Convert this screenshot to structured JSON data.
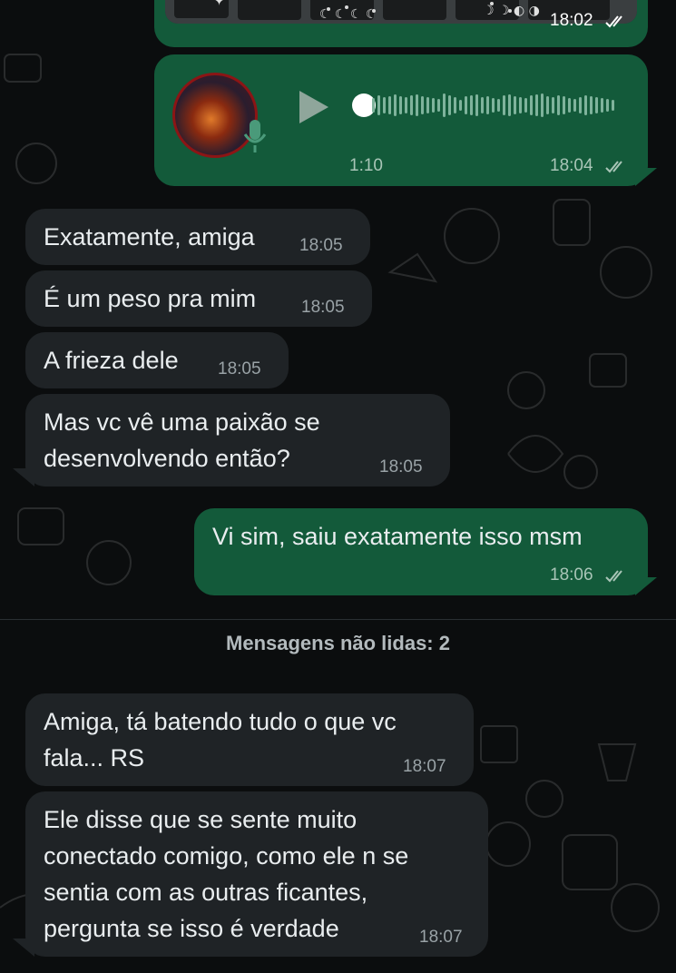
{
  "colors": {
    "background": "#0b0d0e",
    "incoming_bubble": "#1f2326",
    "outgoing_bubble": "#135a3a",
    "timestamp": "#9aa3a7"
  },
  "image_message": {
    "time": "18:02"
  },
  "voice_message": {
    "duration": "1:10",
    "time": "18:04",
    "icon": "play-icon",
    "progress": 0
  },
  "messages": [
    {
      "text": "Exatamente, amiga",
      "time": "18:05"
    },
    {
      "text": "É um peso pra mim",
      "time": "18:05"
    },
    {
      "text": "A frieza dele",
      "time": "18:05"
    },
    {
      "text": "Mas vc vê uma paixão se\ndesenvolvendo então?",
      "time": "18:05"
    },
    {
      "text": "Vi sim, saiu exatamente isso msm",
      "time": "18:06"
    },
    {
      "text": "Amiga, tá batendo tudo o que vc\nfala... RS",
      "time": "18:07"
    },
    {
      "text": "Ele disse que se sente muito\nconectado comigo, como ele n se\nsentia com as outras ficantes,\npergunta se isso é verdade",
      "time": "18:07"
    }
  ],
  "unread_divider": {
    "label": "Mensagens não lidas: 2"
  }
}
